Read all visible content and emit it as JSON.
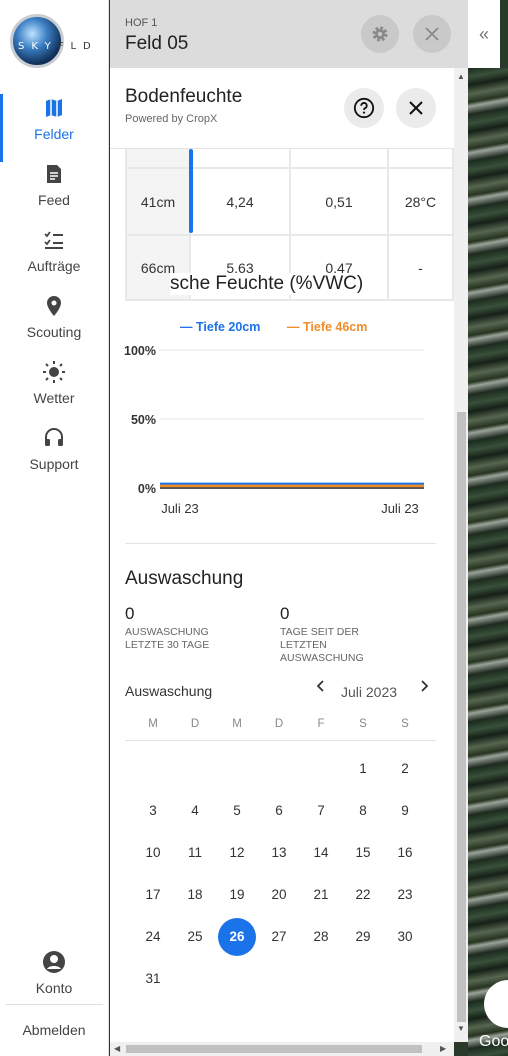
{
  "sidebar": {
    "logo_text": "SKYFLD",
    "items": [
      {
        "label": "Felder",
        "icon": "map-icon",
        "active": true
      },
      {
        "label": "Feed",
        "icon": "feed-icon"
      },
      {
        "label": "Aufträge",
        "icon": "tasks-icon"
      },
      {
        "label": "Scouting",
        "icon": "pin-icon"
      },
      {
        "label": "Wetter",
        "icon": "sun-icon"
      },
      {
        "label": "Support",
        "icon": "headset-icon"
      }
    ],
    "account_label": "Konto",
    "logout_label": "Abmelden"
  },
  "header": {
    "farm": "HOF 1",
    "field": "Feld 05"
  },
  "panel": {
    "title": "Bodenfeuchte",
    "subtitle": "Powered by CropX"
  },
  "table": {
    "rows": [
      {
        "depth": "41cm",
        "a": "4,24",
        "b": "0,51",
        "c": "28°C"
      },
      {
        "depth": "66cm",
        "a": "5,63",
        "b": "0,47",
        "c": "-"
      }
    ],
    "overlay_title": "sche Feuchte (%VWC)"
  },
  "chart_data": {
    "type": "line",
    "series": [
      {
        "name": "Tiefe 20cm",
        "color": "#1a73e8",
        "values": [
          3,
          3
        ]
      },
      {
        "name": "Tiefe 46cm",
        "color": "#f28c28",
        "values": [
          3,
          3
        ]
      }
    ],
    "x": [
      "Juli 23",
      "Juli 23"
    ],
    "ytick_labels": [
      "100%",
      "50%",
      "0%"
    ],
    "ylim": [
      0,
      100
    ],
    "grid": true,
    "legend": "top"
  },
  "leaching": {
    "title": "Auswaschung",
    "stats": [
      {
        "value": "0",
        "label_lines": [
          "AUSWASCHUNG",
          "LETZTE 30 TAGE"
        ]
      },
      {
        "value": "0",
        "label_lines": [
          "TAGE SEIT DER",
          "LETZTEN",
          "AUSWASCHUNG"
        ]
      }
    ]
  },
  "calendar": {
    "label": "Auswaschung",
    "month": "Juli 2023",
    "prev": "‹",
    "next": "›",
    "weekdays": [
      "M",
      "D",
      "M",
      "D",
      "F",
      "S",
      "S"
    ],
    "selected_day": 26,
    "first_weekday_index": 5,
    "days_in_month": 31
  },
  "map": {
    "attribution": "Goo"
  }
}
